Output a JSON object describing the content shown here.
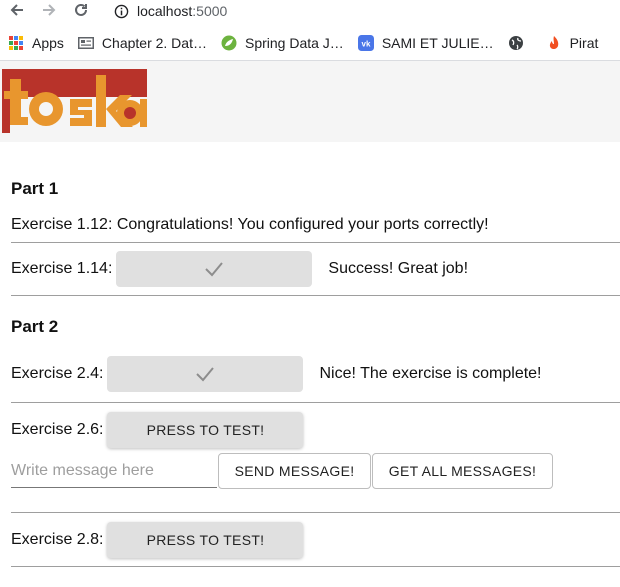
{
  "browser": {
    "url_host": "localhost",
    "url_port": ":5000",
    "bookmarks": [
      {
        "label": "Apps",
        "icon": "apps-grid-icon"
      },
      {
        "label": "Chapter 2. Dat…",
        "icon": "document-icon"
      },
      {
        "label": "Spring Data J…",
        "icon": "spring-leaf-icon"
      },
      {
        "label": "SAMI ET JULIE…",
        "icon": "vk-icon"
      },
      {
        "label": "",
        "icon": "globe-icon"
      },
      {
        "label": "Pirat",
        "icon": "flame-icon"
      }
    ]
  },
  "logo": {
    "alt": "toska"
  },
  "part1": {
    "title": "Part 1",
    "ex112_text": "Exercise 1.12: Congratulations! You configured your ports correctly!",
    "ex114_label": "Exercise 1.14:",
    "ex114_status": "Success! Great job!"
  },
  "part2": {
    "title": "Part 2",
    "ex24_label": "Exercise 2.4:",
    "ex24_status": "Nice! The exercise is complete!",
    "ex26_label": "Exercise 2.6:",
    "ex26_button": "PRESS TO TEST!",
    "message_placeholder": "Write message here",
    "send_button": "SEND MESSAGE!",
    "get_all_button": "GET ALL MESSAGES!",
    "ex28_label": "Exercise 2.8:",
    "ex28_button": "PRESS TO TEST!"
  },
  "colors": {
    "logo_orange": "#e8962e",
    "logo_red": "#b8332a",
    "button_grey": "#e0e0e0",
    "divider": "#9e9e9e"
  }
}
